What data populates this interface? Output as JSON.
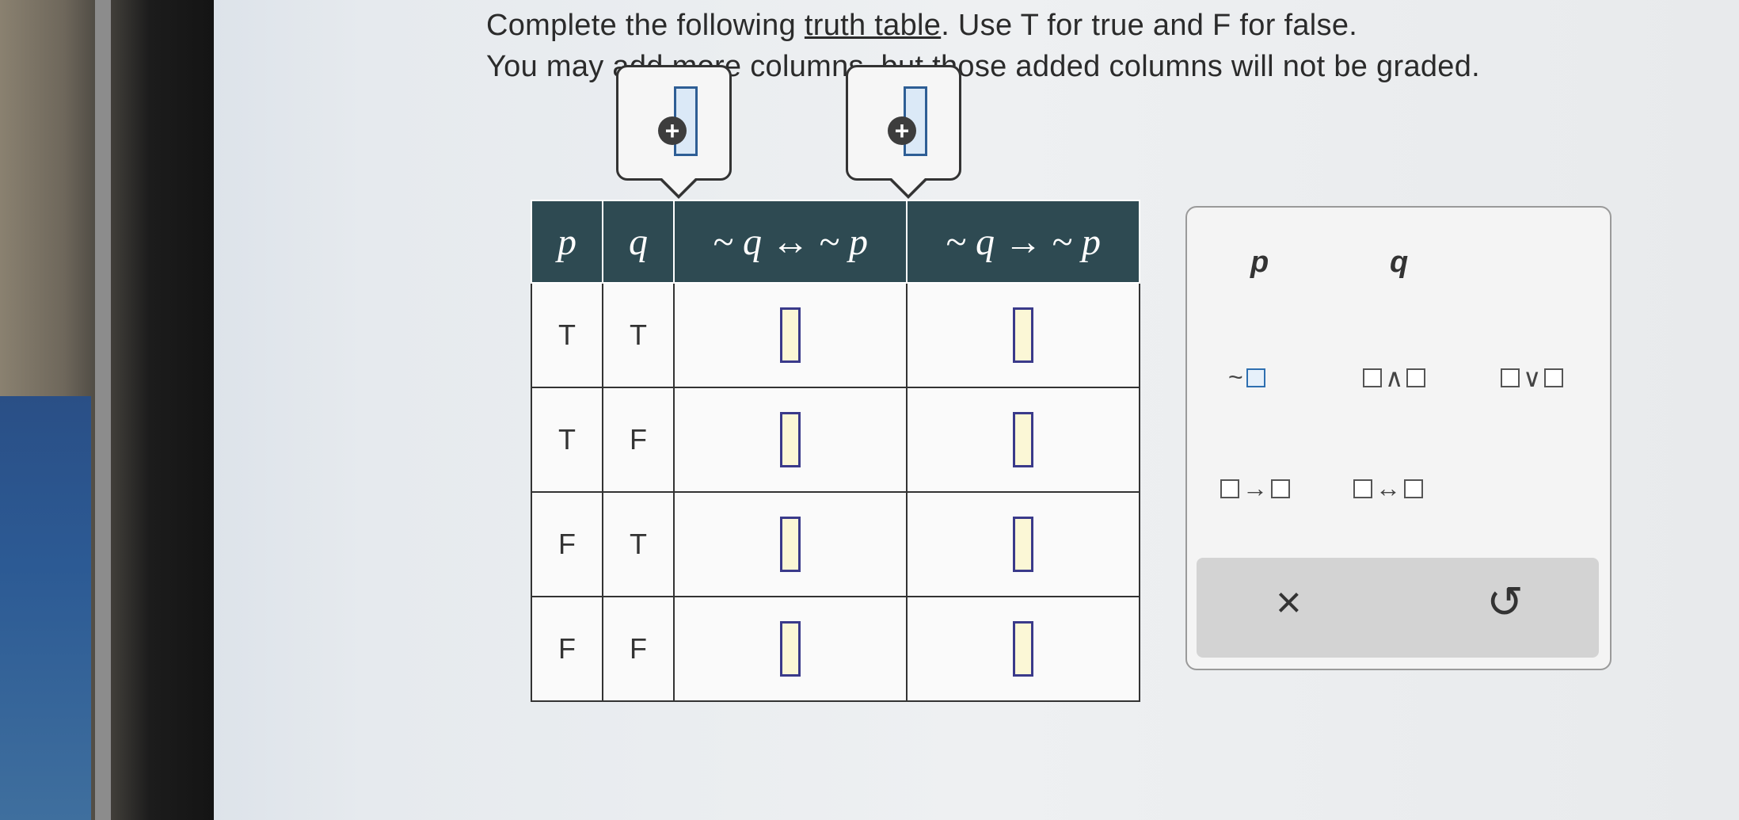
{
  "instructions": {
    "line1_pre": "Complete the following ",
    "line1_link": "truth table",
    "line1_post": ". Use T for true and F for false.",
    "line2": "You may add more columns, but those added columns will not be graded."
  },
  "adders": [
    {
      "icon": "plus-circle-icon",
      "symbol": "+"
    },
    {
      "icon": "plus-circle-icon",
      "symbol": "+"
    }
  ],
  "table": {
    "headers": [
      "p",
      "q",
      "~ q ↔ ~ p",
      "~ q → ~ p"
    ],
    "rows": [
      {
        "p": "T",
        "q": "T"
      },
      {
        "p": "T",
        "q": "F"
      },
      {
        "p": "F",
        "q": "T"
      },
      {
        "p": "F",
        "q": "F"
      }
    ]
  },
  "palette": {
    "variables": [
      "p",
      "q"
    ],
    "operators": [
      {
        "name": "negation",
        "symbol": "~"
      },
      {
        "name": "and",
        "symbol": "∧"
      },
      {
        "name": "or",
        "symbol": "∨"
      },
      {
        "name": "implies",
        "symbol": "→"
      },
      {
        "name": "biconditional",
        "symbol": "↔"
      }
    ],
    "actions": {
      "clear": "×",
      "undo": "↺"
    }
  }
}
